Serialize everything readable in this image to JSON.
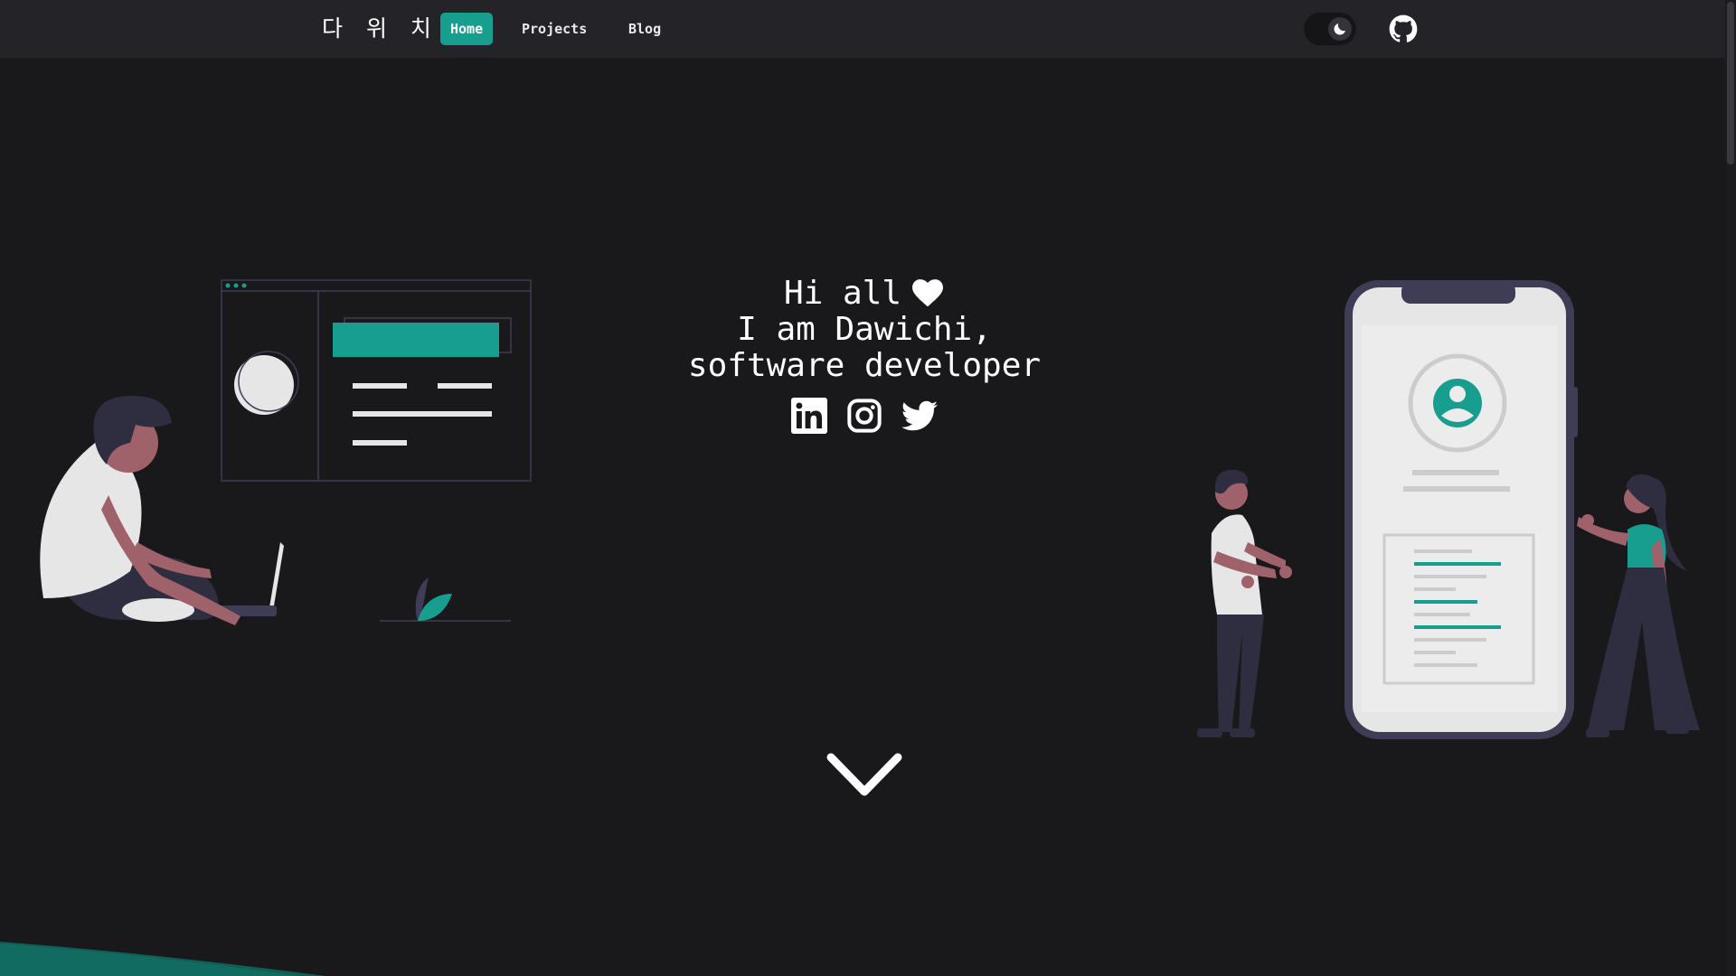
{
  "navbar": {
    "brand": "다 위 치",
    "links": [
      {
        "label": "Home",
        "active": true
      },
      {
        "label": "Projects",
        "active": false
      },
      {
        "label": "Blog",
        "active": false
      }
    ],
    "theme_toggle_icon": "moon-icon",
    "github_icon": "github-icon"
  },
  "hero": {
    "greeting": "Hi all",
    "greeting_icon": "heart-icon",
    "line2": "I am Dawichi,",
    "line3": "software developer",
    "social_icons": [
      "linkedin-icon",
      "instagram-icon",
      "twitter-icon"
    ],
    "scroll_icon": "chevron-down-icon"
  },
  "colors": {
    "background": "#19191b",
    "navbar": "#242428",
    "accent": "#179e8f",
    "text": "#ffffff"
  }
}
